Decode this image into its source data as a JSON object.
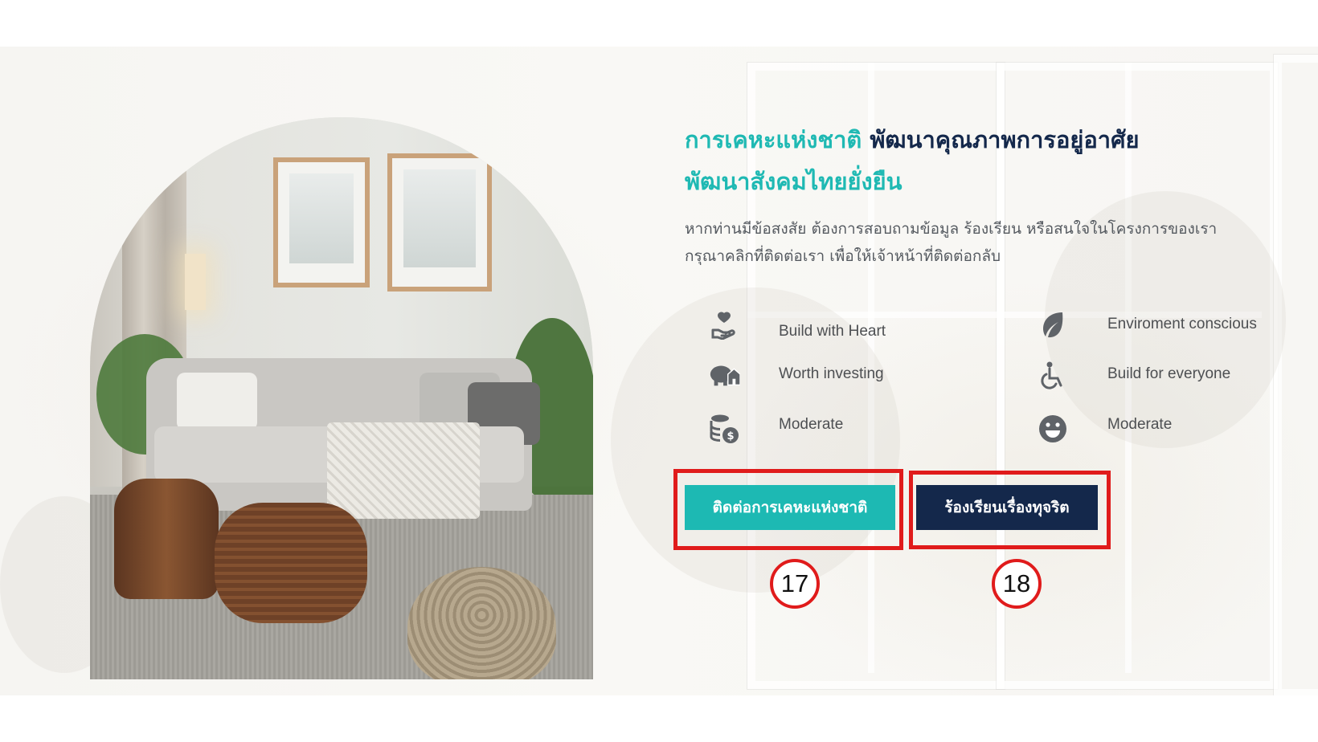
{
  "heading": {
    "line1_teal": "การเคหะแห่งชาติ",
    "line1_navy": "พัฒนาคุณภาพการอยู่อาศัย",
    "line2_teal": "พัฒนาสังคมไทยยั่งยืน"
  },
  "description": {
    "line1": "หากท่านมีข้อสงสัย ต้องการสอบถามข้อมูล ร้องเรียน หรือสนใจในโครงการของเรา",
    "line2": "กรุณาคลิกที่ติดต่อเรา เพื่อให้เจ้าหน้าที่ติดต่อกลับ"
  },
  "features": [
    {
      "label": "Build with Heart",
      "icon": "heart-hand-icon"
    },
    {
      "label": "Enviroment conscious",
      "icon": "leaf-icon"
    },
    {
      "label": "Worth investing",
      "icon": "piggy-bank-house-icon"
    },
    {
      "label": "Build for everyone",
      "icon": "wheelchair-icon"
    },
    {
      "label": "Moderate",
      "icon": "coins-icon"
    },
    {
      "label": "Moderate",
      "icon": "smiley-icon"
    }
  ],
  "buttons": {
    "contact_label": "ติดต่อการเคหะแห่งชาติ",
    "complaint_label": "ร้องเรียนเรื่องทุจริต"
  },
  "annotations": {
    "badge_17": "17",
    "badge_18": "18",
    "highlight_color": "#e01b1b"
  },
  "colors": {
    "teal": "#1db9b3",
    "navy": "#14284b",
    "icon_gray": "#5f6368"
  }
}
